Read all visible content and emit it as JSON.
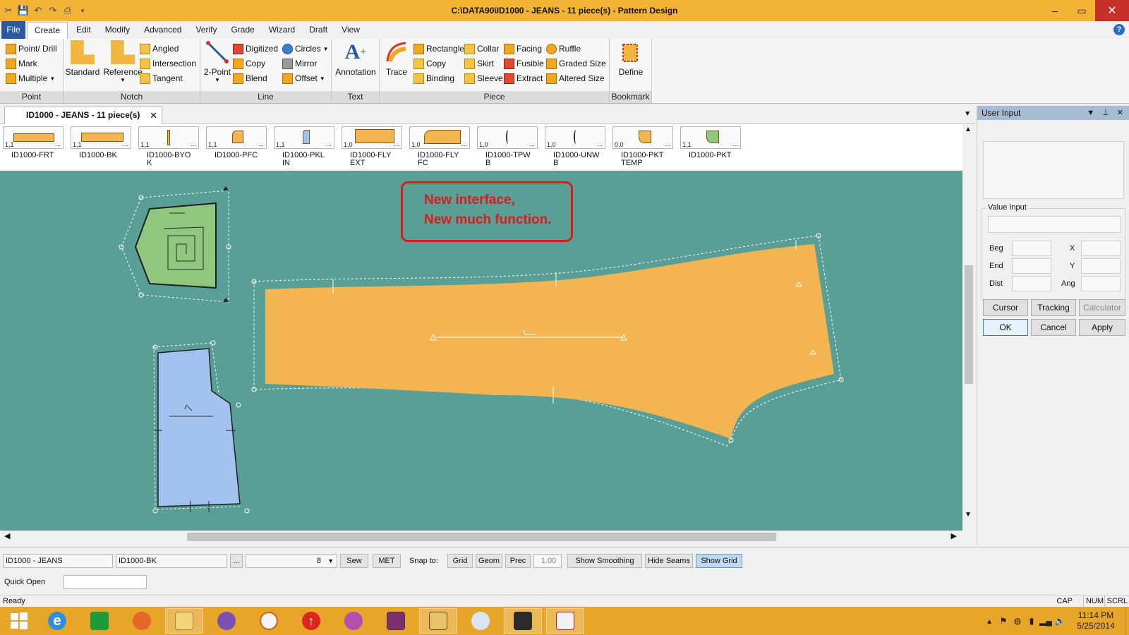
{
  "window": {
    "title": "C:\\DATA90\\ID1000 - JEANS  -  11 piece(s) - Pattern Design",
    "min": "–",
    "max": "▭",
    "close": "✕"
  },
  "menu": {
    "file": "File",
    "items": [
      "Create",
      "Edit",
      "Modify",
      "Advanced",
      "Verify",
      "Grade",
      "Wizard",
      "Draft",
      "View"
    ]
  },
  "ribbon": {
    "point": {
      "label": "Point",
      "items": [
        "Point/ Drill",
        "Mark",
        "Multiple"
      ]
    },
    "notch": {
      "label": "Notch",
      "standard": "Standard",
      "reference": "Reference",
      "items": [
        "Angled",
        "Intersection",
        "Tangent"
      ]
    },
    "line": {
      "label": "Line",
      "twopoint": "2-Point",
      "items": [
        "Digitized",
        "Copy",
        "Blend",
        "Circles",
        "Mirror",
        "Offset"
      ]
    },
    "text": {
      "label": "Text",
      "annotation": "Annotation"
    },
    "piece": {
      "label": "Piece",
      "trace": "Trace",
      "items": [
        "Rectangle",
        "Copy",
        "Binding",
        "Collar",
        "Skirt",
        "Sleeve",
        "Facing",
        "Fusible",
        "Extract",
        "Ruffle",
        "Graded Size",
        "Altered Size"
      ]
    },
    "bookmark": {
      "label": "Bookmark",
      "define": "Define"
    }
  },
  "doc_tab": {
    "label": "ID1000 - JEANS  -  11 piece(s)",
    "close": "✕"
  },
  "pieces": [
    {
      "name": "ID1000-FRT",
      "value": "1,1",
      "more": "..."
    },
    {
      "name": "ID1000-BK",
      "value": "1,1",
      "more": "..."
    },
    {
      "name": "ID1000-BYO\nK",
      "value": "1,1",
      "more": "..."
    },
    {
      "name": "ID1000-PFC",
      "value": "1,1",
      "more": "..."
    },
    {
      "name": "ID1000-PKL\nIN",
      "value": "1,1",
      "more": "..."
    },
    {
      "name": "ID1000-FLY\nEXT",
      "value": "1,0",
      "more": "..."
    },
    {
      "name": "ID1000-FLY\nFC",
      "value": "1,0",
      "more": "..."
    },
    {
      "name": "ID1000-TPW\nB",
      "value": "1,0",
      "more": "..."
    },
    {
      "name": "ID1000-UNW\nB",
      "value": "1,0",
      "more": "..."
    },
    {
      "name": "ID1000-PKT\nTEMP",
      "value": "0,0",
      "more": "..."
    },
    {
      "name": "ID1000-PKT",
      "value": "1,1",
      "more": "..."
    }
  ],
  "annotation": {
    "line1": "New interface,",
    "line2": "New much function."
  },
  "user_input": {
    "title": "User Input",
    "value_input": "Value Input",
    "labels": {
      "beg": "Beg",
      "end": "End",
      "dist": "Dist",
      "x": "X",
      "y": "Y",
      "ang": "Ang"
    },
    "buttons": {
      "cursor": "Cursor",
      "tracking": "Tracking",
      "calculator": "Calculator",
      "ok": "OK",
      "cancel": "Cancel",
      "apply": "Apply"
    }
  },
  "statusbar": {
    "style": "ID1000 - JEANS",
    "piece": "ID1000-BK",
    "browse": "...",
    "size": "8",
    "sew": "Sew",
    "met": "MET",
    "snap_to": "Snap to:",
    "grid": "Grid",
    "geom": "Geom",
    "prec": "Prec",
    "prec_value": "1.00",
    "show_smoothing": "Show Smoothing",
    "hide_seams": "Hide Seams",
    "show_grid": "Show Grid",
    "quick_open": "Quick Open"
  },
  "ready": {
    "text": "Ready",
    "cap": "CAP",
    "num": "NUM",
    "scrl": "SCRL"
  },
  "clock": {
    "time": "11:14 PM",
    "date": "5/25/2014"
  },
  "taskbar_icons": [
    "start-icon",
    "internet-explorer-icon",
    "store-icon",
    "firefox-icon",
    "file-explorer-icon",
    "viber-icon",
    "search-tool-icon",
    "upload-arrow-icon",
    "game-icon",
    "winrar-icon",
    "folder-icon",
    "paint-icon",
    "movie-icon",
    "pattern-app-icon"
  ],
  "colors": {
    "canvas": "#5a9f96",
    "titlebar": "#f3b335",
    "piece_orange": "#f2b552",
    "piece_green": "#8fc77e",
    "piece_blue": "#a3c2ef",
    "annotation_red": "#d81c1c",
    "taskbar": "#e7a62a"
  }
}
